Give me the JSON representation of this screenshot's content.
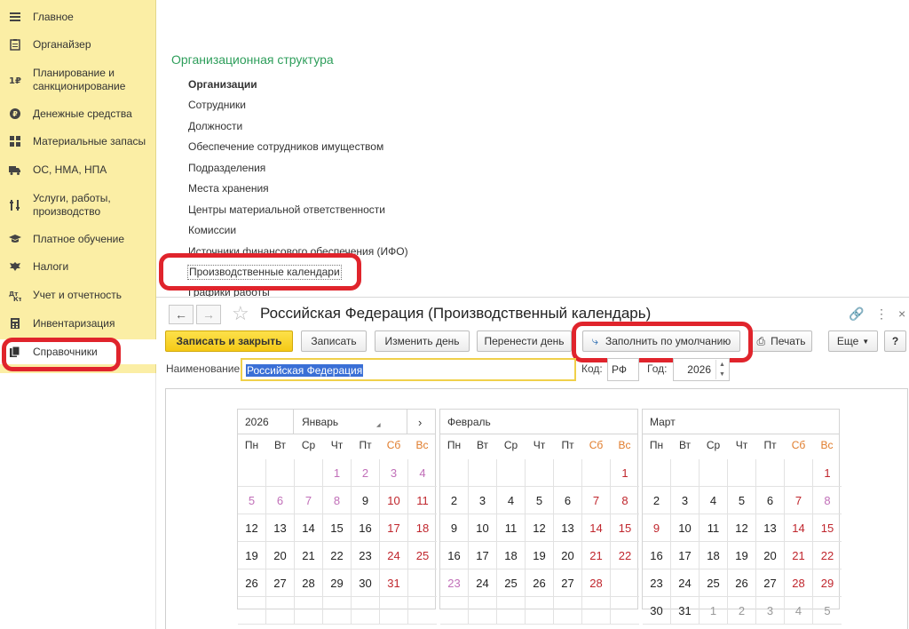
{
  "sidebar": {
    "items": [
      {
        "label": "Главное",
        "icon": "menu-icon"
      },
      {
        "label": "Органайзер",
        "icon": "clipboard-icon"
      },
      {
        "label": "Планирование и санкционирование",
        "icon": "planning-icon"
      },
      {
        "label": "Денежные средства",
        "icon": "coin-icon"
      },
      {
        "label": "Материальные запасы",
        "icon": "grid-icon"
      },
      {
        "label": "ОС, НМА, НПА",
        "icon": "truck-icon"
      },
      {
        "label": "Услуги, работы, производство",
        "icon": "tools-icon"
      },
      {
        "label": "Платное обучение",
        "icon": "graduation-cap-icon"
      },
      {
        "label": "Налоги",
        "icon": "eagle-icon"
      },
      {
        "label": "Учет и отчетность",
        "icon": "accounting-icon"
      },
      {
        "label": "Инвентаризация",
        "icon": "calculator-icon"
      },
      {
        "label": "Справочники",
        "icon": "books-icon"
      }
    ]
  },
  "org": {
    "title": "Организационная структура",
    "links": [
      "Организации",
      "Сотрудники",
      "Должности",
      "Обеспечение сотрудников имуществом",
      "Подразделения",
      "Места хранения",
      "Центры материальной ответственности",
      "Комиссии",
      "Источники финансового обеспечения (ИФО)",
      "Производственные календари",
      "Графики работы"
    ]
  },
  "window": {
    "title": "Российская Федерация (Производственный календарь)",
    "buttons": {
      "save_close": "Записать и закрыть",
      "save": "Записать",
      "change_day": "Изменить день",
      "move_day": "Перенести день",
      "fill_default": "Заполнить по умолчанию",
      "print": "Печать",
      "more": "Еще",
      "help": "?"
    },
    "fields": {
      "name_label": "Наименование:",
      "name_value": "Российская Федерация",
      "code_label": "Код:",
      "code_value": "РФ",
      "year_label": "Год:",
      "year_value": "2026"
    }
  },
  "calendar": {
    "weekdays": [
      "Пн",
      "Вт",
      "Ср",
      "Чт",
      "Пт",
      "Сб",
      "Вс"
    ],
    "year": "2026",
    "months": [
      {
        "name": "Январь",
        "rows": [
          [
            {
              "d": ""
            },
            {
              "d": ""
            },
            {
              "d": ""
            },
            {
              "d": "1",
              "t": "o"
            },
            {
              "d": "2",
              "t": "o"
            },
            {
              "d": "3",
              "t": "o"
            },
            {
              "d": "4",
              "t": "o"
            }
          ],
          [
            {
              "d": "5",
              "t": "o"
            },
            {
              "d": "6",
              "t": "o"
            },
            {
              "d": "7",
              "t": "o"
            },
            {
              "d": "8",
              "t": "o"
            },
            {
              "d": "9"
            },
            {
              "d": "10",
              "t": "h"
            },
            {
              "d": "11",
              "t": "h"
            }
          ],
          [
            {
              "d": "12"
            },
            {
              "d": "13"
            },
            {
              "d": "14"
            },
            {
              "d": "15"
            },
            {
              "d": "16"
            },
            {
              "d": "17",
              "t": "h"
            },
            {
              "d": "18",
              "t": "h"
            }
          ],
          [
            {
              "d": "19"
            },
            {
              "d": "20"
            },
            {
              "d": "21"
            },
            {
              "d": "22"
            },
            {
              "d": "23"
            },
            {
              "d": "24",
              "t": "h"
            },
            {
              "d": "25",
              "t": "h"
            }
          ],
          [
            {
              "d": "26"
            },
            {
              "d": "27"
            },
            {
              "d": "28"
            },
            {
              "d": "29"
            },
            {
              "d": "30"
            },
            {
              "d": "31",
              "t": "h"
            },
            {
              "d": ""
            }
          ],
          [
            {
              "d": ""
            },
            {
              "d": ""
            },
            {
              "d": ""
            },
            {
              "d": ""
            },
            {
              "d": ""
            },
            {
              "d": ""
            },
            {
              "d": ""
            }
          ]
        ]
      },
      {
        "name": "Февраль",
        "rows": [
          [
            {
              "d": ""
            },
            {
              "d": ""
            },
            {
              "d": ""
            },
            {
              "d": ""
            },
            {
              "d": ""
            },
            {
              "d": ""
            },
            {
              "d": "1",
              "t": "h"
            }
          ],
          [
            {
              "d": "2"
            },
            {
              "d": "3"
            },
            {
              "d": "4"
            },
            {
              "d": "5"
            },
            {
              "d": "6"
            },
            {
              "d": "7",
              "t": "h"
            },
            {
              "d": "8",
              "t": "h"
            }
          ],
          [
            {
              "d": "9"
            },
            {
              "d": "10"
            },
            {
              "d": "11"
            },
            {
              "d": "12"
            },
            {
              "d": "13"
            },
            {
              "d": "14",
              "t": "h"
            },
            {
              "d": "15",
              "t": "h"
            }
          ],
          [
            {
              "d": "16"
            },
            {
              "d": "17"
            },
            {
              "d": "18"
            },
            {
              "d": "19"
            },
            {
              "d": "20"
            },
            {
              "d": "21",
              "t": "h"
            },
            {
              "d": "22",
              "t": "h"
            }
          ],
          [
            {
              "d": "23",
              "t": "o"
            },
            {
              "d": "24"
            },
            {
              "d": "25"
            },
            {
              "d": "26"
            },
            {
              "d": "27"
            },
            {
              "d": "28",
              "t": "h"
            },
            {
              "d": ""
            }
          ],
          [
            {
              "d": ""
            },
            {
              "d": ""
            },
            {
              "d": ""
            },
            {
              "d": ""
            },
            {
              "d": ""
            },
            {
              "d": ""
            },
            {
              "d": ""
            }
          ]
        ]
      },
      {
        "name": "Март",
        "rows": [
          [
            {
              "d": ""
            },
            {
              "d": ""
            },
            {
              "d": ""
            },
            {
              "d": ""
            },
            {
              "d": ""
            },
            {
              "d": ""
            },
            {
              "d": "1",
              "t": "h"
            }
          ],
          [
            {
              "d": "2"
            },
            {
              "d": "3"
            },
            {
              "d": "4"
            },
            {
              "d": "5"
            },
            {
              "d": "6"
            },
            {
              "d": "7",
              "t": "h"
            },
            {
              "d": "8",
              "t": "o"
            }
          ],
          [
            {
              "d": "9",
              "t": "h"
            },
            {
              "d": "10"
            },
            {
              "d": "11"
            },
            {
              "d": "12"
            },
            {
              "d": "13"
            },
            {
              "d": "14",
              "t": "h"
            },
            {
              "d": "15",
              "t": "h"
            }
          ],
          [
            {
              "d": "16"
            },
            {
              "d": "17"
            },
            {
              "d": "18"
            },
            {
              "d": "19"
            },
            {
              "d": "20"
            },
            {
              "d": "21",
              "t": "h"
            },
            {
              "d": "22",
              "t": "h"
            }
          ],
          [
            {
              "d": "23"
            },
            {
              "d": "24"
            },
            {
              "d": "25"
            },
            {
              "d": "26"
            },
            {
              "d": "27"
            },
            {
              "d": "28",
              "t": "h"
            },
            {
              "d": "29",
              "t": "h"
            }
          ],
          [
            {
              "d": "30"
            },
            {
              "d": "31"
            },
            {
              "d": "1",
              "t": "g"
            },
            {
              "d": "2",
              "t": "g"
            },
            {
              "d": "3",
              "t": "g"
            },
            {
              "d": "4",
              "t": "g"
            },
            {
              "d": "5",
              "t": "g"
            }
          ]
        ]
      }
    ]
  },
  "colors": {
    "sidebar_bg": "#fbeea5",
    "highlight_red": "#e0242c",
    "org_title_green": "#2e9e5b",
    "primary_button": "#f5c916",
    "holiday_red": "#c0262d",
    "weekend_header": "#e07b2a",
    "other_day_pink": "#c16fb8"
  }
}
